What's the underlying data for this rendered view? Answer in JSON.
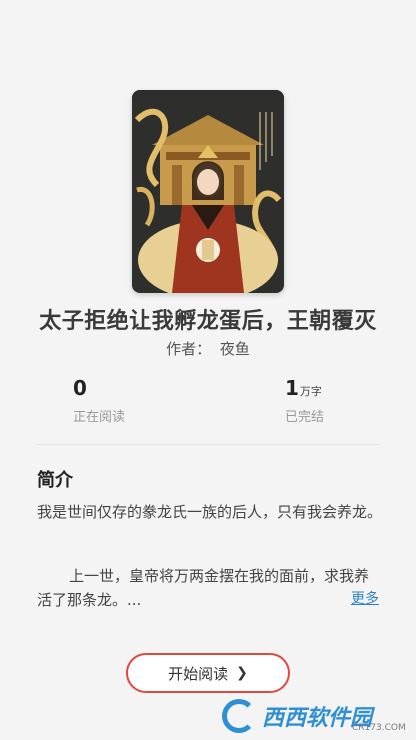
{
  "book": {
    "title": "太子拒绝让我孵龙蛋后，王朝覆灭",
    "author_label": "作者：",
    "author_name": "夜鱼"
  },
  "stats": {
    "reading_count": "0",
    "reading_label": "正在阅读",
    "word_count": "1",
    "word_unit": "万字",
    "status_label": "已完结"
  },
  "intro": {
    "heading": "简介",
    "paragraph1": "我是世间仅存的豢龙氏一族的后人，只有我会养龙。",
    "paragraph2": "上一世，皇帝将万两金摆在我的面前，求我养活了那条龙。...",
    "more_label": "更多"
  },
  "actions": {
    "start_reading_label": "开始阅读",
    "start_reading_icon": "chevron-right-icon"
  },
  "watermark": {
    "text": "西西软件园",
    "sub": "CR173.COM"
  },
  "colors": {
    "button_border": "#e0493e",
    "link": "#2d83c6",
    "background": "#f4f4f4"
  }
}
